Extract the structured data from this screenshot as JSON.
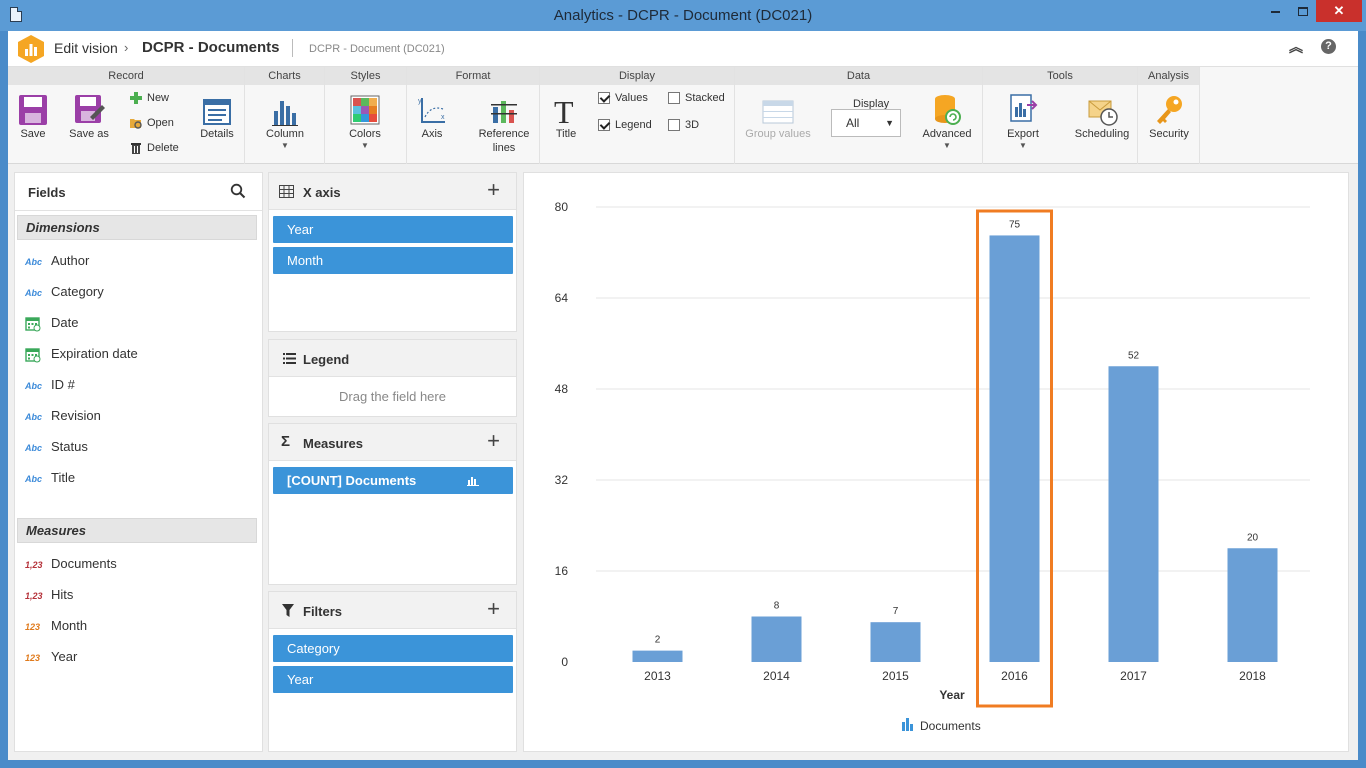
{
  "window": {
    "title": "Analytics - DCPR - Document (DC021)"
  },
  "header": {
    "edit_label": "Edit vision",
    "doc_title": "DCPR - Documents",
    "doc_subtitle": "DCPR - Document (DC021)",
    "help": "?"
  },
  "ribbon": {
    "groups": {
      "record": "Record",
      "charts": "Charts",
      "styles": "Styles",
      "format": "Format",
      "display": "Display",
      "data": "Data",
      "tools": "Tools",
      "analysis": "Analysis"
    },
    "save": "Save",
    "save_as": "Save as",
    "new": "New",
    "open": "Open",
    "delete": "Delete",
    "details": "Details",
    "column": "Column",
    "colors": "Colors",
    "axis": "Axis",
    "reference_lines_1": "Reference",
    "reference_lines_2": "lines",
    "title": "Title",
    "values": "Values",
    "legend": "Legend",
    "stacked": "Stacked",
    "three_d": "3D",
    "group_values": "Group values",
    "display_label": "Display",
    "display_value": "All",
    "advanced": "Advanced",
    "export": "Export",
    "scheduling": "Scheduling",
    "security": "Security"
  },
  "fields": {
    "title": "Fields",
    "dimensions_header": "Dimensions",
    "dimensions": [
      {
        "type": "Abc",
        "label": "Author"
      },
      {
        "type": "Abc",
        "label": "Category"
      },
      {
        "type": "cal",
        "label": "Date"
      },
      {
        "type": "cal",
        "label": "Expiration date"
      },
      {
        "type": "Abc",
        "label": "ID #"
      },
      {
        "type": "Abc",
        "label": "Revision"
      },
      {
        "type": "Abc",
        "label": "Status"
      },
      {
        "type": "Abc",
        "label": "Title"
      }
    ],
    "measures_header": "Measures",
    "measures": [
      {
        "type": "1,23",
        "label": "Documents"
      },
      {
        "type": "1,23",
        "label": "Hits"
      },
      {
        "type": "123",
        "label": "Month"
      },
      {
        "type": "123",
        "label": "Year"
      }
    ]
  },
  "x_axis": {
    "title": "X axis",
    "items": [
      "Year",
      "Month"
    ]
  },
  "legend": {
    "title": "Legend",
    "hint": "Drag the field here"
  },
  "measures": {
    "title": "Measures",
    "items": [
      "[COUNT] Documents"
    ]
  },
  "filters": {
    "title": "Filters",
    "items": [
      "Category",
      "Year"
    ]
  },
  "colors": {
    "accent": "#3b94d9",
    "bar": "#6a9fd6",
    "highlight": "#f07c22"
  },
  "chart_data": {
    "type": "bar",
    "categories": [
      "2013",
      "2014",
      "2015",
      "2016",
      "2017",
      "2018"
    ],
    "series": [
      {
        "name": "Documents",
        "values": [
          2,
          8,
          7,
          75,
          52,
          20
        ]
      }
    ],
    "xlabel": "Year",
    "ylabel": "",
    "ylim": [
      0,
      80
    ],
    "yticks": [
      0,
      16,
      32,
      48,
      64,
      80
    ],
    "grid": true,
    "legend": "bottom-center",
    "highlighted_category": "2016"
  }
}
